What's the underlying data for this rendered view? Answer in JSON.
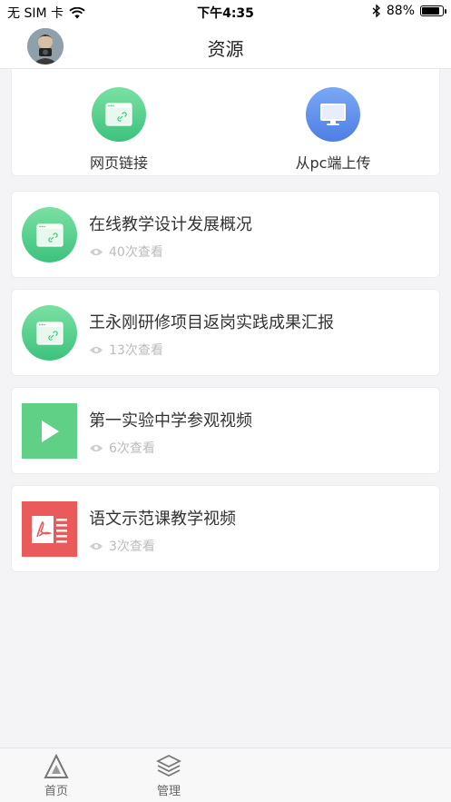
{
  "status_bar": {
    "carrier": "无 SIM 卡",
    "time": "下午4:35",
    "battery": "88%",
    "battery_level": 0.88
  },
  "nav": {
    "title": "资源",
    "avatar_icon": "user-avatar"
  },
  "upload_options": [
    {
      "label": "网页链接",
      "icon": "web-link-icon",
      "color": "#4cc985"
    },
    {
      "label": "从pc端上传",
      "icon": "monitor-icon",
      "color": "#5b8be8"
    }
  ],
  "resources": [
    {
      "title": "在线教学设计发展概况",
      "views": "40次查看",
      "type": "web",
      "icon": "web-link-icon"
    },
    {
      "title": "王永刚研修项目返岗实践成果汇报",
      "views": "13次查看",
      "type": "web",
      "icon": "web-link-icon"
    },
    {
      "title": "第一实验中学参观视频",
      "views": "6次查看",
      "type": "video",
      "icon": "play-icon"
    },
    {
      "title": "语文示范课教学视频",
      "views": "3次查看",
      "type": "pdf",
      "icon": "pdf-icon"
    }
  ],
  "tabs": [
    {
      "label": "首页",
      "icon": "triangle-home-icon"
    },
    {
      "label": "管理",
      "icon": "layers-icon"
    }
  ],
  "colors": {
    "green": "#4cc985",
    "blue": "#5b8be8",
    "video_green": "#5fd086",
    "pdf_red": "#ea5a5a",
    "background": "#f4f4f6"
  }
}
